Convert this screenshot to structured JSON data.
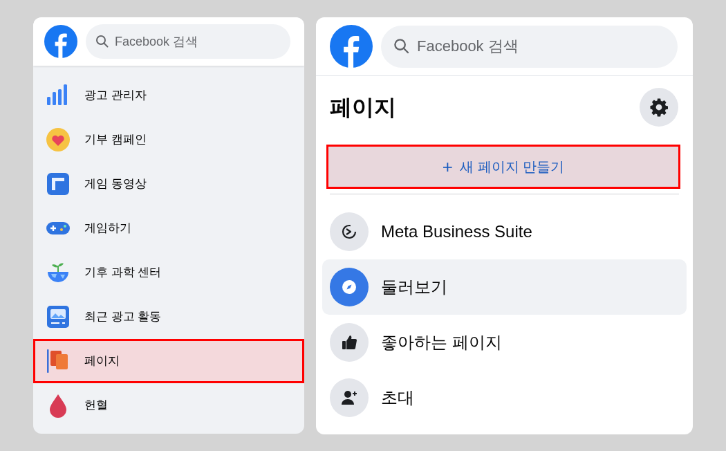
{
  "left_panel": {
    "search": {
      "placeholder": "Facebook 검색"
    },
    "items": [
      {
        "label": "광고 관리자",
        "highlighted": false
      },
      {
        "label": "기부 캠페인",
        "highlighted": false
      },
      {
        "label": "게임 동영상",
        "highlighted": false
      },
      {
        "label": "게임하기",
        "highlighted": false
      },
      {
        "label": "기후 과학 센터",
        "highlighted": false
      },
      {
        "label": "최근 광고 활동",
        "highlighted": false
      },
      {
        "label": "페이지",
        "highlighted": true
      },
      {
        "label": "헌혈",
        "highlighted": false
      }
    ]
  },
  "right_panel": {
    "search": {
      "placeholder": "Facebook 검색"
    },
    "title": "페이지",
    "create_button": {
      "icon": "+",
      "label": "새 페이지 만들기",
      "highlighted": true
    },
    "items": [
      {
        "label": "Meta Business Suite",
        "selected": false
      },
      {
        "label": "둘러보기",
        "selected": true
      },
      {
        "label": "좋아하는 페이지",
        "selected": false
      },
      {
        "label": "초대",
        "selected": false
      }
    ]
  }
}
